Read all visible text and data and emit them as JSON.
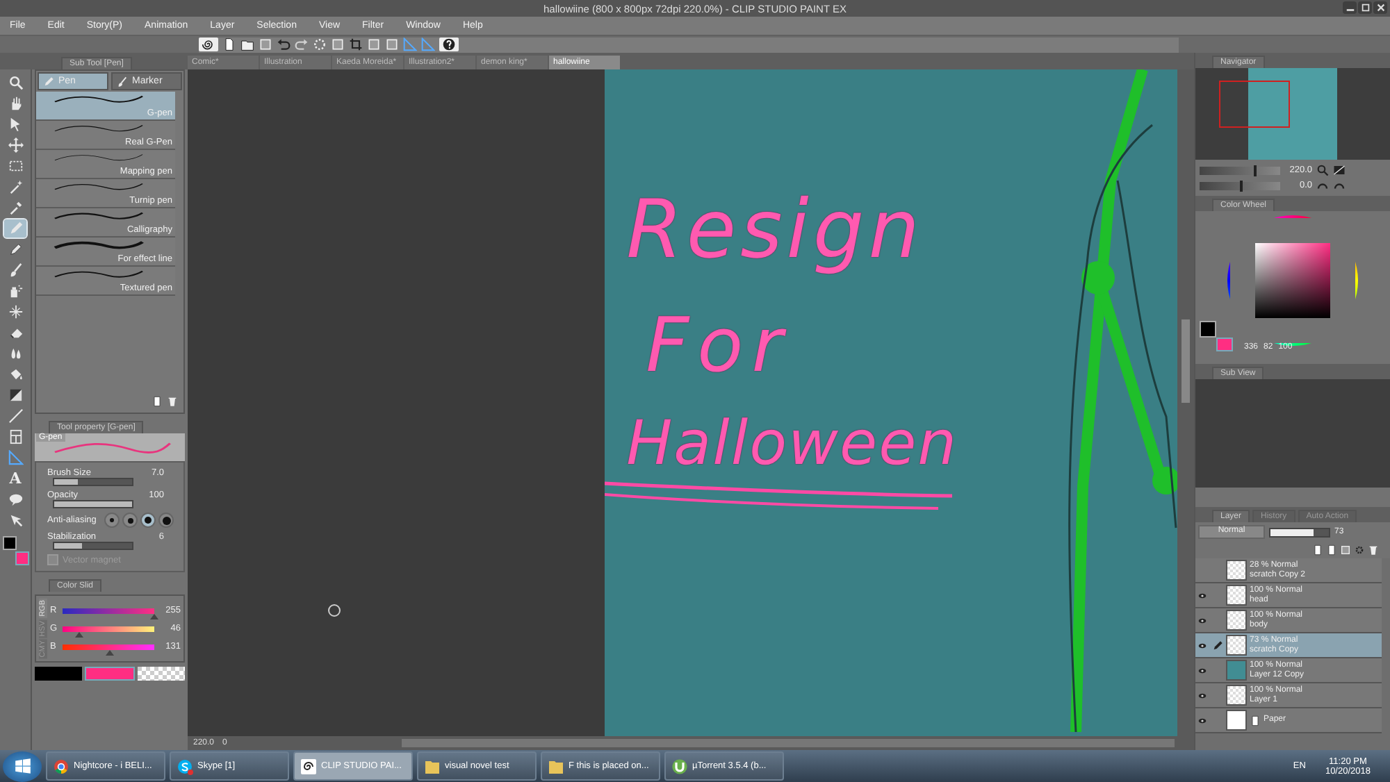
{
  "window": {
    "title": "hallowiine (800 x 800px 72dpi 220.0%) - CLIP STUDIO PAINT EX"
  },
  "menu": [
    "File",
    "Edit",
    "Story(P)",
    "Animation",
    "Layer",
    "Selection",
    "View",
    "Filter",
    "Window",
    "Help"
  ],
  "document_tabs": [
    {
      "label": "Comic*",
      "selected": false
    },
    {
      "label": "Illustration",
      "selected": false
    },
    {
      "label": "Kaeda Moreida*",
      "selected": false
    },
    {
      "label": "Illustration2*",
      "selected": false
    },
    {
      "label": "demon king*",
      "selected": false
    },
    {
      "label": "hallowiine",
      "selected": true
    }
  ],
  "toolbox": [
    {
      "kind": "zoom",
      "selected": false
    },
    {
      "kind": "hand",
      "selected": false
    },
    {
      "kind": "object",
      "selected": false
    },
    {
      "kind": "move",
      "selected": false
    },
    {
      "kind": "select",
      "selected": false
    },
    {
      "kind": "wand",
      "selected": false
    },
    {
      "kind": "dropper",
      "selected": false
    },
    {
      "kind": "pen",
      "selected": true
    },
    {
      "kind": "pencil",
      "selected": false
    },
    {
      "kind": "brush",
      "selected": false
    },
    {
      "kind": "airbrush",
      "selected": false
    },
    {
      "kind": "decoration",
      "selected": false
    },
    {
      "kind": "eraser",
      "selected": false
    },
    {
      "kind": "blend",
      "selected": false
    },
    {
      "kind": "fill",
      "selected": false
    },
    {
      "kind": "gradient",
      "selected": false
    },
    {
      "kind": "figure",
      "selected": false
    },
    {
      "kind": "frame",
      "selected": false
    },
    {
      "kind": "ruler",
      "selected": false
    },
    {
      "kind": "text",
      "selected": false,
      "glyph": "A"
    },
    {
      "kind": "balloon",
      "selected": false
    },
    {
      "kind": "correct",
      "selected": false
    }
  ],
  "sub_tool": {
    "title": "Sub Tool [Pen]",
    "groups": [
      {
        "label": "Pen",
        "selected": true
      },
      {
        "label": "Marker",
        "selected": false
      }
    ],
    "brushes": [
      {
        "name": "G-pen",
        "selected": true
      },
      {
        "name": "Real G-Pen",
        "selected": false
      },
      {
        "name": "Mapping pen",
        "selected": false
      },
      {
        "name": "Turnip pen",
        "selected": false
      },
      {
        "name": "Calligraphy",
        "selected": false
      },
      {
        "name": "For effect line",
        "selected": false
      },
      {
        "name": "Textured pen",
        "selected": false
      }
    ]
  },
  "tool_property": {
    "title": "Tool property [G-pen]",
    "preview_label": "G-pen",
    "brush_size": {
      "label": "Brush Size",
      "value": "7.0",
      "level": 0.3
    },
    "opacity": {
      "label": "Opacity",
      "value": "100",
      "level": 1
    },
    "anti_aliasing": {
      "label": "Anti-aliasing",
      "options": [
        {
          "selected": false
        },
        {
          "selected": false
        },
        {
          "selected": true
        },
        {
          "selected": false
        }
      ]
    },
    "stabilization": {
      "label": "Stabilization",
      "value": "6",
      "level": 0.35
    },
    "vector_magnet": {
      "label": "Vector magnet",
      "checked": false
    }
  },
  "color_slider": {
    "title": "Color Slid",
    "modes": [
      {
        "label": "RGB",
        "selected": true
      },
      {
        "label": "HSV",
        "selected": false
      },
      {
        "label": "CMY",
        "selected": false
      }
    ],
    "channels": [
      {
        "name": "R",
        "value": "255",
        "level": 1
      },
      {
        "name": "G",
        "value": "46",
        "level": 0.18
      },
      {
        "name": "B",
        "value": "131",
        "level": 0.51
      }
    ]
  },
  "canvas": {
    "lines": [
      "Resign",
      "For",
      "Halloween"
    ]
  },
  "status_bar": {
    "zoom": "220.0",
    "angle": "0"
  },
  "navigator": {
    "title": "Navigator",
    "zoom": {
      "value": "220.0",
      "level": 0.68
    },
    "angle": {
      "value": "0.0",
      "level": 0.5
    }
  },
  "color_wheel": {
    "title": "Color Wheel",
    "hue": "336",
    "saturation": "82",
    "brightness": "100"
  },
  "sub_view": {
    "title": "Sub View"
  },
  "layer_panel": {
    "tabs": [
      {
        "label": "Layer",
        "selected": true
      },
      {
        "label": "History",
        "selected": false
      },
      {
        "label": "Auto Action",
        "selected": false
      }
    ],
    "blend_mode": "Normal",
    "opacity": {
      "value": "73",
      "level": 0.73
    },
    "layers": [
      {
        "mode": "28 % Normal",
        "name": "scratch Copy 2",
        "visible": false,
        "selected": false,
        "kind": "raster"
      },
      {
        "mode": "100 % Normal",
        "name": "head",
        "visible": true,
        "selected": false,
        "kind": "raster"
      },
      {
        "mode": "100 % Normal",
        "name": "body",
        "visible": true,
        "selected": false,
        "kind": "raster"
      },
      {
        "mode": "73 % Normal",
        "name": "scratch Copy",
        "visible": true,
        "selected": true,
        "kind": "raster"
      },
      {
        "mode": "100 % Normal",
        "name": "Layer 12 Copy",
        "visible": true,
        "selected": false,
        "kind": "fill"
      },
      {
        "mode": "100 % Normal",
        "name": "Layer 1",
        "visible": true,
        "selected": false,
        "kind": "raster"
      },
      {
        "name": "Paper",
        "visible": true,
        "selected": false,
        "kind": "paper"
      }
    ]
  },
  "taskbar": {
    "items": [
      {
        "kind": "chrome",
        "label": "Nightcore - i BELI...",
        "active": false
      },
      {
        "kind": "skype",
        "label": "Skype [1]",
        "active": false
      },
      {
        "kind": "clip",
        "label": "CLIP STUDIO PAI...",
        "active": true
      },
      {
        "kind": "folder",
        "label": "visual novel test",
        "active": false
      },
      {
        "kind": "folder",
        "label": "F this is placed on...",
        "active": false
      },
      {
        "kind": "torrent",
        "label": "µTorrent 3.5.4  (b...",
        "active": false
      }
    ],
    "language": "EN",
    "time": "11:20 PM",
    "date": "10/20/2018"
  }
}
